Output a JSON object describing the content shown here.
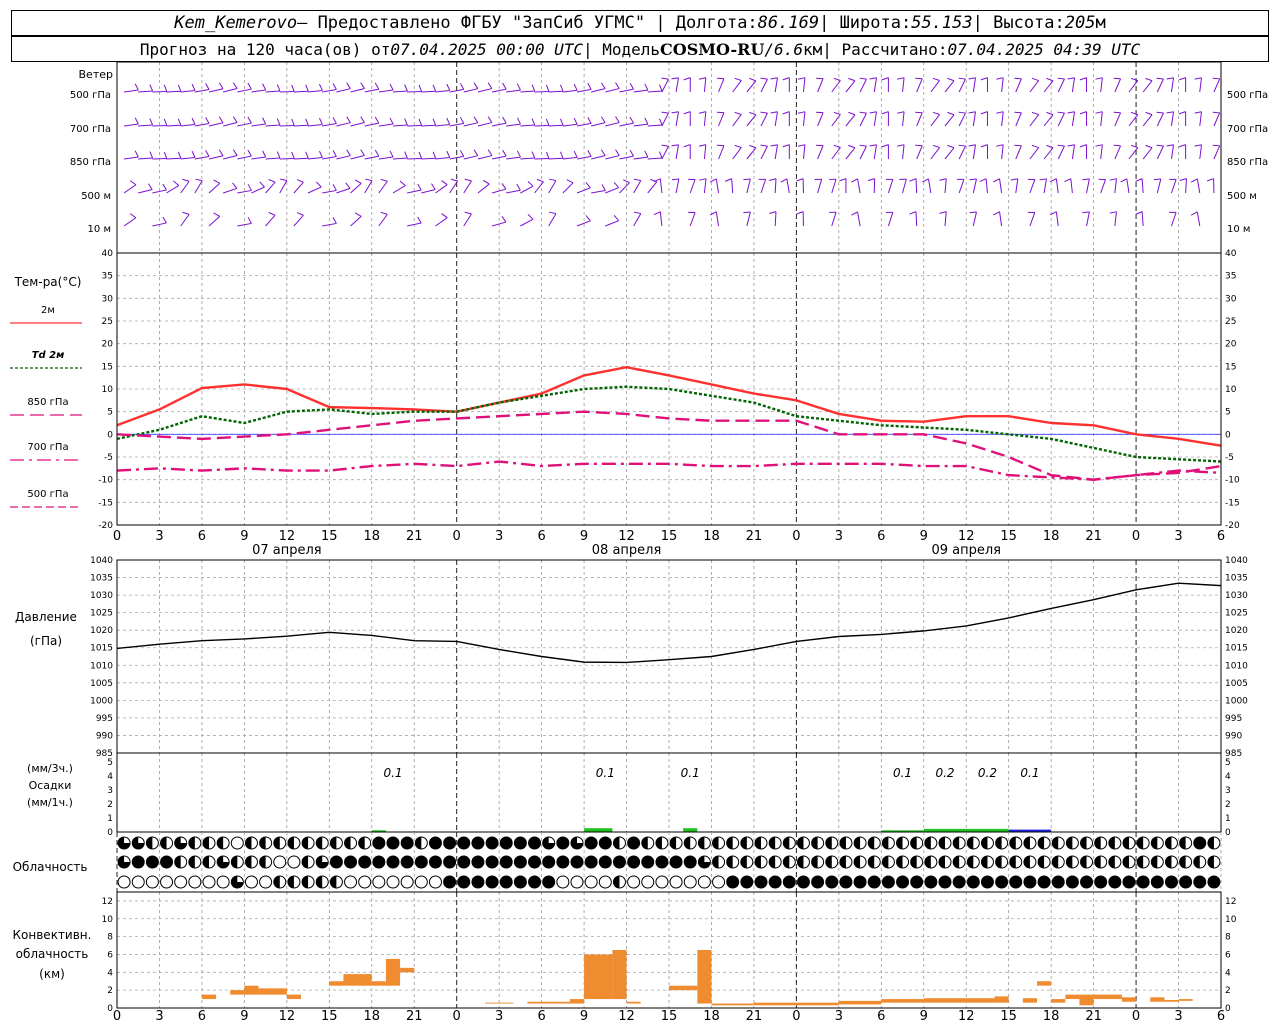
{
  "header": {
    "station": "Kem_Kemerovo",
    "provider": " — Предоставлено ФГБУ \"ЗапСиб УГМС\" | Долгота: ",
    "lon": "86.169",
    "lat_label": " | Широта: ",
    "lat": "55.153",
    "alt_label": " | Высота: ",
    "alt": "205",
    "alt_unit": "м",
    "forecast_label": "Прогноз на 120 часа(ов) от ",
    "forecast_start": "07.04.2025 00:00 UTC",
    "model_label": " | Модель ",
    "model": "COSMO-RU",
    "model_sep": " / ",
    "resolution": "6.6",
    "res_unit": "км",
    "calc_label": " | Рассчитано: ",
    "calc_time": "07.04.2025 04:39 UTC"
  },
  "labels": {
    "wind": "Ветер",
    "levels": [
      "500 гПа",
      "700 гПа",
      "850 гПа",
      "500 м",
      "10  м"
    ],
    "temp_title": "Тем-ра(°С)",
    "legend": [
      "2м",
      "Td  2м",
      "850 гПа",
      "700 гПа",
      "500 гПа"
    ],
    "pressure": "Давление",
    "pressure_unit": "(гПа)",
    "precip_top": "(мм/3ч.)",
    "precip": "Осадки",
    "precip_bottom": "(мм/1ч.)",
    "clouds": "Облачность",
    "conv1": "Конвективн.",
    "conv2": "облачность",
    "conv3": "(км)",
    "dates": [
      "07 апреля",
      "08 апреля",
      "09 апреля"
    ]
  },
  "colors": {
    "t2m": "#ff3030",
    "td2m": "#006400",
    "t850": "#e0107a",
    "t700": "#e0107a",
    "t500": "#e0107a",
    "wind": "#7b10d0",
    "pressure": "#000000",
    "precip_rain": "#20c020",
    "precip_snow": "#2020e0",
    "convective": "#f08c30",
    "zero_line": "#4040ff"
  },
  "chart_data": [
    {
      "type": "line",
      "name": "temperature",
      "x_unit": "hours from 07.04.2025 00 UTC",
      "x_ticks": [
        "0",
        "3",
        "6",
        "9",
        "12",
        "15",
        "18",
        "21",
        "0",
        "3",
        "6",
        "9",
        "12",
        "15",
        "18",
        "21",
        "0",
        "3",
        "6",
        "9",
        "12",
        "15",
        "18",
        "21",
        "0",
        "3",
        "6"
      ],
      "ylim": [
        -20,
        40
      ],
      "yticks": [
        -20,
        -15,
        -10,
        -5,
        0,
        5,
        10,
        15,
        20,
        25,
        30,
        35,
        40
      ],
      "series": [
        {
          "name": "2м",
          "style": "solid",
          "x": [
            0,
            3,
            6,
            9,
            12,
            15,
            18,
            21,
            24,
            27,
            30,
            33,
            36,
            39,
            42,
            45,
            48,
            51,
            54,
            57,
            60,
            63,
            66,
            69,
            72,
            75,
            78
          ],
          "values": [
            2,
            5.5,
            10.2,
            11,
            10,
            6,
            5.8,
            5.5,
            5,
            7,
            9,
            13,
            14.8,
            13,
            11,
            9,
            7.5,
            4.5,
            3,
            2.8,
            4,
            4,
            2.5,
            2,
            0,
            -1,
            -2.5
          ]
        },
        {
          "name": "Td  2м",
          "style": "dotted",
          "x": [
            0,
            3,
            6,
            9,
            12,
            15,
            18,
            21,
            24,
            27,
            30,
            33,
            36,
            39,
            42,
            45,
            48,
            51,
            54,
            57,
            60,
            63,
            66,
            69,
            72,
            75,
            78
          ],
          "values": [
            -1,
            1,
            4,
            2.5,
            5,
            5.5,
            4.5,
            5,
            5,
            7,
            8.5,
            10,
            10.5,
            10,
            8.5,
            7,
            4,
            3,
            2,
            1.5,
            1,
            0,
            -1,
            -3,
            -5,
            -5.5,
            -6
          ]
        },
        {
          "name": "850 гПа",
          "style": "dashed",
          "x": [
            0,
            3,
            6,
            9,
            12,
            15,
            18,
            21,
            24,
            27,
            30,
            33,
            36,
            39,
            42,
            45,
            48,
            51,
            54,
            57,
            60,
            63,
            66,
            69,
            72,
            75,
            78
          ],
          "values": [
            0,
            -0.5,
            -1,
            -0.5,
            0,
            1,
            2,
            3,
            3.5,
            4,
            4.5,
            5,
            4.5,
            3.5,
            3,
            3,
            3,
            0,
            0,
            0,
            -2,
            -5,
            -9,
            -10,
            -9,
            -8.5,
            -7
          ]
        },
        {
          "name": "700 гПа",
          "style": "dashdot",
          "x": [
            0,
            3,
            6,
            9,
            12,
            15,
            18,
            21,
            24,
            27,
            30,
            33,
            36,
            39,
            42,
            45,
            48,
            51,
            54,
            57,
            60,
            63,
            66,
            69,
            72,
            75,
            78
          ],
          "values": [
            -8,
            -7.5,
            -8,
            -7.5,
            -8,
            -8,
            -7,
            -6.5,
            -7,
            -6,
            -7,
            -6.5,
            -6.5,
            -6.5,
            -7,
            -7,
            -6.5,
            -6.5,
            -6.5,
            -7,
            -7,
            -9,
            -9.5,
            -10,
            -9,
            -8,
            -8.5
          ]
        }
      ]
    },
    {
      "type": "line",
      "name": "pressure",
      "ylim": [
        985,
        1040
      ],
      "yticks": [
        985,
        990,
        995,
        1000,
        1005,
        1010,
        1015,
        1020,
        1025,
        1030,
        1035,
        1040
      ],
      "x": [
        0,
        3,
        6,
        9,
        12,
        15,
        18,
        21,
        24,
        27,
        30,
        33,
        36,
        39,
        42,
        45,
        48,
        51,
        54,
        57,
        60,
        63,
        66,
        69,
        72,
        75,
        78
      ],
      "values": [
        1014.8,
        1016,
        1017,
        1017.5,
        1018.3,
        1019.4,
        1018.5,
        1017,
        1016.8,
        1014.5,
        1012.5,
        1010.9,
        1010.8,
        1011.6,
        1012.5,
        1014.5,
        1016.8,
        1018.2,
        1018.8,
        1019.8,
        1021.2,
        1023.5,
        1026.2,
        1028.7,
        1031.5,
        1033.4,
        1032.7
      ]
    },
    {
      "type": "bar",
      "name": "precipitation",
      "ylim": [
        0,
        5
      ],
      "labels": [
        {
          "x": 19.5,
          "text": "0.1"
        },
        {
          "x": 34.5,
          "text": "0.1"
        },
        {
          "x": 40.5,
          "text": "0.1"
        },
        {
          "x": 55.5,
          "text": "0.1"
        },
        {
          "x": 58.5,
          "text": "0.2"
        },
        {
          "x": 61.5,
          "text": "0.2"
        },
        {
          "x": 64.5,
          "text": "0.1"
        }
      ],
      "bars": [
        {
          "x0": 18,
          "x1": 19,
          "value": 0.05,
          "kind": "rain"
        },
        {
          "x0": 33,
          "x1": 35,
          "value": 0.2,
          "kind": "rain"
        },
        {
          "x0": 40,
          "x1": 41,
          "value": 0.2,
          "kind": "rain"
        },
        {
          "x0": 54,
          "x1": 57,
          "value": 0.05,
          "kind": "rain"
        },
        {
          "x0": 57,
          "x1": 63,
          "value": 0.15,
          "kind": "rain"
        },
        {
          "x0": 63,
          "x1": 66,
          "value": 0.1,
          "kind": "snow"
        }
      ]
    },
    {
      "type": "table",
      "name": "cloudiness",
      "rows": [
        "dqhhqhhhohhhhhhhhhfffhffffffffqfqffhfhhhhhhhhhhhhhhhhhhhhhhhhhhhhhhhhhhhhhhhfhhhhhhhhhhhhhhhhhhhhhhhhhhhhhhhhhhhhhhhhhhhhhhhhhhh",
        "dfffhhhdhhhoohdffffffffffffffffffffffffffdhhhhhhhhhhhhhhhhhhhhhhhhhhhhhhhhhhhhhhhhhhhhhhhhhhhhhhhhhhhhhhhhhhhhhhhhhhhhhhhhhhhh",
        "oooooooodoohhhhhoooooooffffffffoooohoooooooffffffffffffffffffffffffffffffffffffffffhffffffffffffffffffffffffffoooooooooohfooooo"
      ]
    },
    {
      "type": "bar",
      "name": "convective",
      "ylim": [
        0,
        13
      ],
      "yticks": [
        0,
        2,
        4,
        6,
        8,
        10,
        12
      ],
      "bars": [
        {
          "x0": 6,
          "x1": 7,
          "bottom": 1,
          "top": 1.5
        },
        {
          "x0": 8,
          "x1": 9,
          "bottom": 1.5,
          "top": 2
        },
        {
          "x0": 9,
          "x1": 10,
          "bottom": 1.5,
          "top": 2.5
        },
        {
          "x0": 10,
          "x1": 12,
          "bottom": 1.5,
          "top": 2.2
        },
        {
          "x0": 12,
          "x1": 13,
          "bottom": 1,
          "top": 1.5
        },
        {
          "x0": 15,
          "x1": 16,
          "bottom": 2.5,
          "top": 3
        },
        {
          "x0": 16,
          "x1": 18,
          "bottom": 2.5,
          "top": 3.8
        },
        {
          "x0": 18,
          "x1": 19,
          "bottom": 2.5,
          "top": 3
        },
        {
          "x0": 19,
          "x1": 20,
          "bottom": 2.5,
          "top": 5.5
        },
        {
          "x0": 20,
          "x1": 21,
          "bottom": 4,
          "top": 4.5
        },
        {
          "x0": 26,
          "x1": 28,
          "bottom": 0.5,
          "top": 0.6
        },
        {
          "x0": 29,
          "x1": 32,
          "bottom": 0.5,
          "top": 0.7
        },
        {
          "x0": 32,
          "x1": 33,
          "bottom": 0.5,
          "top": 1
        },
        {
          "x0": 33,
          "x1": 35,
          "bottom": 1,
          "top": 6
        },
        {
          "x0": 35,
          "x1": 36,
          "bottom": 1,
          "top": 6.5
        },
        {
          "x0": 36,
          "x1": 37,
          "bottom": 0.5,
          "top": 0.7
        },
        {
          "x0": 39,
          "x1": 41,
          "bottom": 2,
          "top": 2.5
        },
        {
          "x0": 41,
          "x1": 42,
          "bottom": 0.5,
          "top": 6.5
        },
        {
          "x0": 42,
          "x1": 45,
          "bottom": 0.3,
          "top": 0.5
        },
        {
          "x0": 45,
          "x1": 51,
          "bottom": 0.3,
          "top": 0.6
        },
        {
          "x0": 51,
          "x1": 54,
          "bottom": 0.4,
          "top": 0.8
        },
        {
          "x0": 54,
          "x1": 57,
          "bottom": 0.6,
          "top": 1
        },
        {
          "x0": 57,
          "x1": 62,
          "bottom": 0.6,
          "top": 1.1
        },
        {
          "x0": 62,
          "x1": 63,
          "bottom": 0.6,
          "top": 1.3
        },
        {
          "x0": 64,
          "x1": 65,
          "bottom": 0.6,
          "top": 1.1
        },
        {
          "x0": 65,
          "x1": 66,
          "bottom": 2.5,
          "top": 3
        },
        {
          "x0": 66,
          "x1": 67,
          "bottom": 0.6,
          "top": 1
        },
        {
          "x0": 67,
          "x1": 68,
          "bottom": 1,
          "top": 1.5
        },
        {
          "x0": 68,
          "x1": 69,
          "bottom": 0.3,
          "top": 1.5
        },
        {
          "x0": 69,
          "x1": 71,
          "bottom": 1,
          "top": 1.5
        },
        {
          "x0": 71,
          "x1": 72,
          "bottom": 0.7,
          "top": 1.2
        },
        {
          "x0": 73,
          "x1": 74,
          "bottom": 0.7,
          "top": 1.2
        },
        {
          "x0": 74,
          "x1": 75,
          "bottom": 0.7,
          "top": 0.9
        },
        {
          "x0": 75,
          "x1": 76,
          "bottom": 0.8,
          "top": 1
        }
      ]
    }
  ]
}
